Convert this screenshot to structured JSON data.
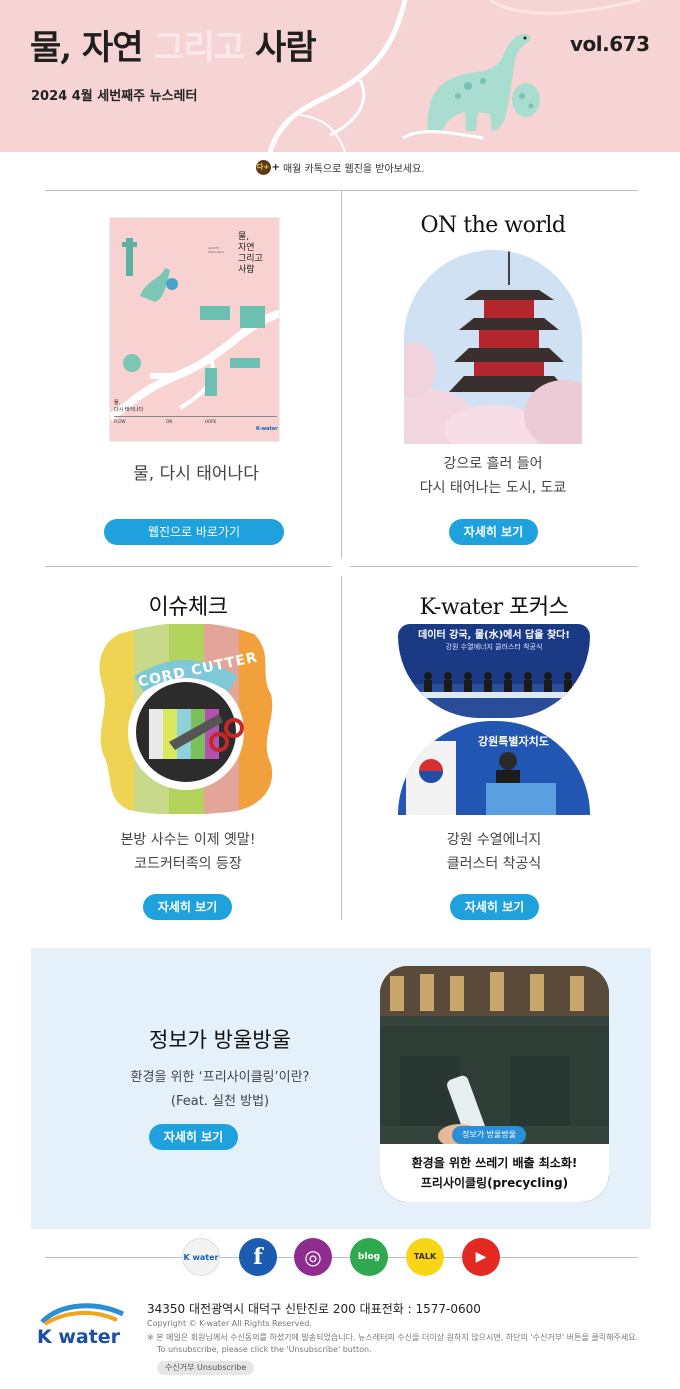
{
  "header": {
    "title_main": "물, 자연 ",
    "title_faint": "그리고",
    "title_end": " 사람",
    "subtitle": "2024 4월 세번째주 뉴스레터",
    "volume": "vol.673"
  },
  "kakao": {
    "badge": "다+",
    "plus": "+",
    "text": "매월 카톡으로 웹진을 받아보세요."
  },
  "cards": [
    {
      "heading": "",
      "cover": {
        "title_lines": [
          "물,",
          "자연",
          "그리고",
          "사람"
        ],
        "vol_line1": "vol.673",
        "vol_line2": "2024 April",
        "bottom_title_1": "물,",
        "bottom_title_2": "다시 태어나다",
        "col_flow": "FLOW",
        "col_on": "ON",
        "col_hope": "HOPE",
        "logo": "K-water"
      },
      "text_line1": "물, 다시 태어나다",
      "text_line2": "",
      "button": "웹진으로 바로가기"
    },
    {
      "heading": "ON the world",
      "text_line1": "강으로 흘러 들어",
      "text_line2": "다시 태어나는 도시, 도쿄",
      "button": "자세히 보기"
    },
    {
      "heading": "이슈체크",
      "art_text": "CORD CUTTER",
      "text_line1": "본방 사수는 이제 옛말!",
      "text_line2": "코드커터족의 등장",
      "button": "자세히 보기"
    },
    {
      "heading": "K-water 포커스",
      "photo_banner": "데이터 강국, 물(水)에서 답을 찾다!",
      "photo_sub": "강원 수열에너지 클러스터 착공식",
      "photo_screen2": "강원특별자치도",
      "text_line1": "강원 수열에너지",
      "text_line2": "클러스터 착공식",
      "button": "자세히 보기"
    }
  ],
  "info": {
    "title": "정보가 방울방울",
    "line1": "환경을 위한 ‘프리사이클링’이란?",
    "line2": "(Feat. 실천 방법)",
    "button": "자세히 보기",
    "photo_badge": "정보가 방울방울",
    "photo_line1": "환경을 위한 쓰레기 배출 최소화!",
    "photo_line2": "프리사이클링(precycling)"
  },
  "social": [
    {
      "name": "kwater",
      "label": "K water",
      "color": "#f4f4f4"
    },
    {
      "name": "facebook",
      "label": "f",
      "color": "#1b5bb0"
    },
    {
      "name": "instagram",
      "label": "◎",
      "color": "#8e2c8f"
    },
    {
      "name": "blog",
      "label": "blog",
      "color": "#2fa84f"
    },
    {
      "name": "kakaotalk",
      "label": "TALK",
      "color": "#f8d616"
    },
    {
      "name": "youtube",
      "label": "▶",
      "color": "#e22a22"
    }
  ],
  "footer": {
    "logo_text": "K water",
    "address": "34350 대전광역시 대덕구 신탄진로 200  대표전화 : 1577-0600",
    "copyright": "Copyright © K-water All Rights Reserved.",
    "notice": "※ 본 메일은 회원님께서 수신동의를 하셨기에 발송되었습니다. 뉴스레터의 수신을 더이상 원하지 않으시면, 하단의 '수신거부' 버튼을 클릭해주세요.",
    "notice_en": "To unsubscribe, please click the 'Unsubscribe' button.",
    "unsubscribe": "수신거부  Unsubscribe"
  },
  "colors": {
    "header_bg": "#f7d4d4",
    "accent_blue": "#1ea1dc",
    "panel_bg": "#e5f1fa"
  }
}
